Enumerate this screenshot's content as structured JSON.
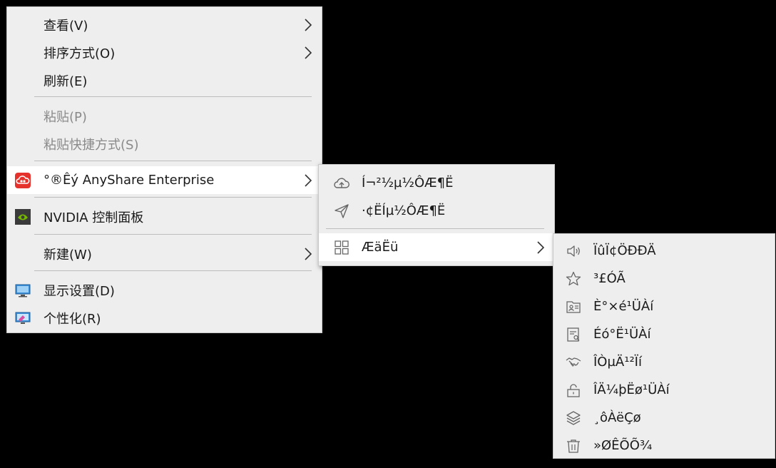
{
  "main_menu": {
    "view": "查看(V)",
    "sort": "排序方式(O)",
    "refresh": "刷新(E)",
    "paste": "粘贴(P)",
    "paste_shortcut": "粘贴快捷方式(S)",
    "anyshare": "°®Êý AnyShare Enterprise",
    "nvidia": "NVIDIA 控制面板",
    "new": "新建(W)",
    "display_settings": "显示设置(D)",
    "personalize": "个性化(R)"
  },
  "anyshare_submenu": {
    "item1": "Í¬²½µ½ÔÆ¶Ë",
    "item2": "·¢ËÍµ½ÔÆ¶Ë",
    "item3": "ÆäËü"
  },
  "more_submenu": {
    "items": [
      "ÏûÏ¢ÖÐÐÄ",
      "³£ÓÃ",
      "È°×é¹ÜÀí",
      "Éó°Ë¹ÜÀí",
      "ÎÒµÄ¹²Ïí",
      "ÎÄ¼þËø¹ÜÀí",
      "¸ôÀëÇø",
      "»ØÊÕÕ¾"
    ]
  },
  "colors": {
    "menu_background": "#eeeeee",
    "hover_background": "#ffffff",
    "disabled_text": "#8a8a8a",
    "anyshare_brand": "#e5322d",
    "nvidia_brand": "#76b900"
  },
  "icons": {
    "anyshare": "anyshare-cloud-icon",
    "nvidia": "nvidia-logo-icon",
    "display": "monitor-icon",
    "personalize": "personalize-icon",
    "sync": "cloud-upload-icon",
    "send": "send-icon",
    "more": "grid-icon",
    "messages": "speaker-icon",
    "favorites": "star-icon",
    "groups": "contact-card-icon",
    "approval": "document-check-icon",
    "shares": "handshake-icon",
    "file_lock": "unlock-icon",
    "quarantine": "layers-icon",
    "recycle": "trash-icon"
  }
}
